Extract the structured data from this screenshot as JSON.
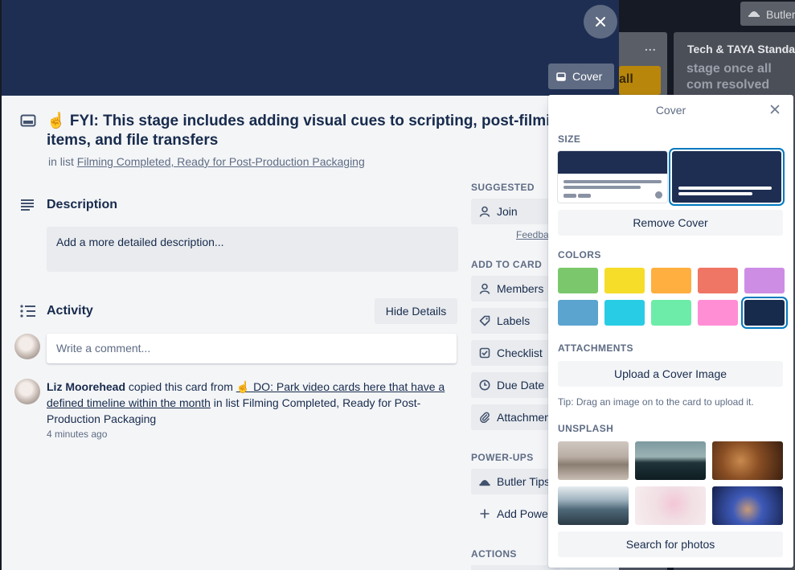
{
  "background": {
    "column_title": "Tech & TAYA Standa",
    "column_dots": "...",
    "card_text": "stage once all com resolved from Alex",
    "yellow_card_text": "all",
    "butler_label": "Butler"
  },
  "card": {
    "cover_color": "#1e2e52",
    "cover_button_label": "Cover",
    "title": "☝️ FYI: This stage includes adding visual cues to scripting, post-filming checklist items, and file transfers",
    "in_list_prefix": "in list",
    "list_name": "Filming Completed, Ready for Post-Production Packaging",
    "description": {
      "heading": "Description",
      "placeholder": "Add a more detailed description..."
    },
    "activity": {
      "heading": "Activity",
      "hide_details_label": "Hide Details",
      "comment_placeholder": "Write a comment...",
      "entries": [
        {
          "user": "Liz Moorehead",
          "action": "copied this card from",
          "source_card": "☝️ DO: Park video cards here that have a defined timeline within the month",
          "list_suffix": "in list Filming Completed, Ready for Post-Production Packaging",
          "time": "4 minutes ago"
        }
      ]
    }
  },
  "sidebar": {
    "suggested_heading": "SUGGESTED",
    "join_label": "Join",
    "feedback_label": "Feedback",
    "add_to_card_heading": "ADD TO CARD",
    "members_label": "Members",
    "labels_label": "Labels",
    "checklist_label": "Checklist",
    "due_date_label": "Due Date",
    "attachment_label": "Attachment",
    "power_ups_heading": "POWER-UPS",
    "butler_tips_label": "Butler Tips",
    "add_power_up_label": "Add Power-Up",
    "actions_heading": "ACTIONS"
  },
  "cover_popover": {
    "title": "Cover",
    "size_heading": "SIZE",
    "remove_cover_label": "Remove Cover",
    "colors_heading": "COLORS",
    "colors": [
      "#7bc86c",
      "#f5dd29",
      "#ffaf3f",
      "#ef7564",
      "#cd8de5",
      "#5ba4cf",
      "#29cce5",
      "#6deca9",
      "#ff8ed4",
      "#172b4d"
    ],
    "selected_color_index": 9,
    "attachments_heading": "ATTACHMENTS",
    "upload_label": "Upload a Cover Image",
    "tip": "Tip: Drag an image on to the card to upload it.",
    "unsplash_heading": "UNSPLASH",
    "search_photos_label": "Search for photos"
  }
}
